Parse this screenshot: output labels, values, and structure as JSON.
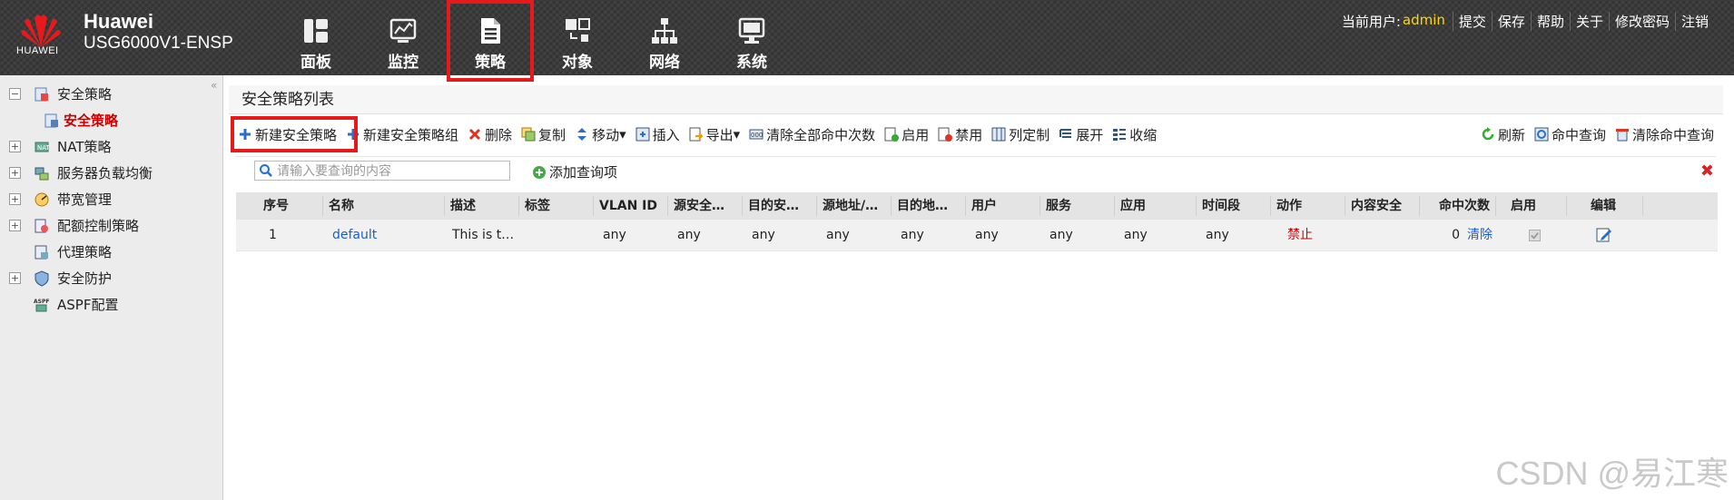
{
  "brand": {
    "name": "Huawei",
    "model": "USG6000V1-ENSP",
    "logo_text": "HUAWEI"
  },
  "nav": [
    {
      "label": "面板",
      "icon": "dashboard-icon",
      "active": false
    },
    {
      "label": "监控",
      "icon": "monitor-icon",
      "active": false
    },
    {
      "label": "策略",
      "icon": "policy-icon",
      "active": true
    },
    {
      "label": "对象",
      "icon": "object-icon",
      "active": false
    },
    {
      "label": "网络",
      "icon": "network-icon",
      "active": false
    },
    {
      "label": "系统",
      "icon": "system-icon",
      "active": false
    }
  ],
  "userbar": {
    "current_user_label": "当前用户:",
    "username": "admin",
    "links": [
      "提交",
      "保存",
      "帮助",
      "关于",
      "修改密码",
      "注销"
    ]
  },
  "sidebar": {
    "collapse": "«",
    "items": [
      {
        "label": "安全策略",
        "expanded": true
      },
      {
        "label": "安全策略",
        "sub": true,
        "active": true
      },
      {
        "label": "NAT策略",
        "expanded": false
      },
      {
        "label": "服务器负载均衡",
        "expanded": false
      },
      {
        "label": "带宽管理",
        "expanded": false
      },
      {
        "label": "配额控制策略",
        "expanded": false
      },
      {
        "label": "代理策略",
        "leaf": true
      },
      {
        "label": "安全防护",
        "expanded": false
      },
      {
        "label": "ASPF配置",
        "leaf": true
      }
    ]
  },
  "panel": {
    "title": "安全策略列表"
  },
  "toolbar": {
    "new_policy": "新建安全策略",
    "new_group": "新建安全策略组",
    "delete": "删除",
    "copy": "复制",
    "move": "移动",
    "insert": "插入",
    "export": "导出",
    "clear_hits": "清除全部命中次数",
    "enable": "启用",
    "disable": "禁用",
    "customize": "列定制",
    "expand": "展开",
    "collapse": "收缩",
    "refresh": "刷新",
    "hit_query": "命中查询",
    "clear_hit_query": "清除命中查询"
  },
  "search": {
    "placeholder": "请输入要查询的内容",
    "add_query": "添加查询项"
  },
  "table": {
    "headers": [
      "序号",
      "名称",
      "描述",
      "标签",
      "VLAN ID",
      "源安全…",
      "目的安…",
      "源地址/…",
      "目的地…",
      "用户",
      "服务",
      "应用",
      "时间段",
      "动作",
      "内容安全",
      "命中次数",
      "启用",
      "编辑"
    ],
    "rows": [
      {
        "no": "1",
        "name": "default",
        "desc": "This is t…",
        "tag": "",
        "vlan": "any",
        "src_zone": "any",
        "dst_zone": "any",
        "src_addr": "any",
        "dst_addr": "any",
        "user": "any",
        "service": "any",
        "app": "any",
        "time": "any",
        "action": "禁止",
        "content": "",
        "hits": "0",
        "clear": "清除",
        "enabled": true
      }
    ]
  },
  "watermark": "CSDN @易江寒",
  "colors": {
    "highlight": "#e8191b",
    "link": "#1a5fd3",
    "deny": "#cc0000",
    "username": "#ffd700"
  }
}
